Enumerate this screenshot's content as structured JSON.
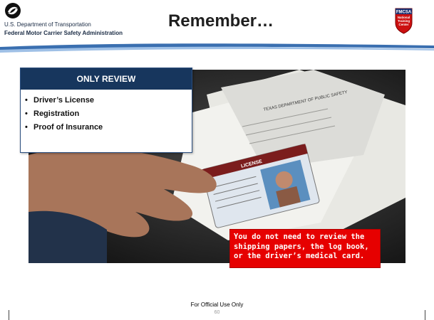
{
  "header": {
    "department": "U.S. Department of Transportation",
    "agency": "Federal Motor Carrier Safety Administration",
    "title": "Remember…",
    "badge_lines": [
      "FMCSA",
      "National",
      "Training",
      "Center"
    ]
  },
  "review_box": {
    "heading": "ONLY REVIEW",
    "items": [
      "Driver’s License",
      "Registration",
      "Proof of Insurance"
    ],
    "bullet": "•"
  },
  "photo": {
    "card_header": "TEXAS DEPARTMENT OF PUBLIC SAFETY",
    "card_label": "LICENSE"
  },
  "note": {
    "text": "You do not need to review the shipping papers, the log book, or the driver’s medical card."
  },
  "footer": {
    "classification": "For Official Use Only",
    "page_number": "60"
  },
  "colors": {
    "navy": "#17365d",
    "note_red": "#e60000",
    "swoosh_blue": "#3a6fb0"
  }
}
